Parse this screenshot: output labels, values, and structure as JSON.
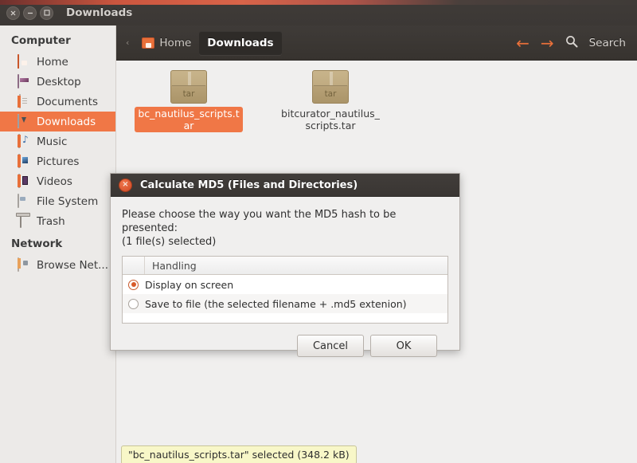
{
  "window": {
    "title": "Downloads",
    "controls": [
      {
        "name": "close",
        "glyph": "×"
      },
      {
        "name": "minimize",
        "glyph": "−"
      },
      {
        "name": "maximize",
        "glyph": "□"
      }
    ]
  },
  "sidebar": {
    "sections": [
      {
        "heading": "Computer",
        "items": [
          {
            "label": "Home",
            "icon": "home-icon",
            "selected": false
          },
          {
            "label": "Desktop",
            "icon": "desktop-icon",
            "selected": false
          },
          {
            "label": "Documents",
            "icon": "documents-icon",
            "selected": false
          },
          {
            "label": "Downloads",
            "icon": "downloads-icon",
            "selected": true
          },
          {
            "label": "Music",
            "icon": "music-icon",
            "selected": false
          },
          {
            "label": "Pictures",
            "icon": "pictures-icon",
            "selected": false
          },
          {
            "label": "Videos",
            "icon": "videos-icon",
            "selected": false
          },
          {
            "label": "File System",
            "icon": "file-system-icon",
            "selected": false
          },
          {
            "label": "Trash",
            "icon": "trash-icon",
            "selected": false
          }
        ]
      },
      {
        "heading": "Network",
        "items": [
          {
            "label": "Browse Net...",
            "icon": "network-icon",
            "selected": false
          }
        ]
      }
    ]
  },
  "toolbar": {
    "separator": "‹",
    "breadcrumbs": [
      {
        "label": "Home",
        "active": false
      },
      {
        "label": "Downloads",
        "active": true
      }
    ],
    "back_glyph": "←",
    "forward_glyph": "→",
    "search_label": "Search"
  },
  "files": [
    {
      "name": "bc_nautilus_scripts.tar",
      "type_label": "tar",
      "selected": true
    },
    {
      "name": "bitcurator_nautilus_scripts.tar",
      "type_label": "tar",
      "selected": false
    }
  ],
  "status": {
    "text": "\"bc_nautilus_scripts.tar\" selected (348.2 kB)"
  },
  "dialog": {
    "title": "Calculate MD5 (Files and Directories)",
    "close_glyph": "×",
    "prompt_line1": "Please choose the way you want the MD5 hash to be presented:",
    "prompt_line2": "(1 file(s) selected)",
    "list": {
      "column_header": "Handling",
      "options": [
        {
          "label": "Display on screen",
          "selected": true
        },
        {
          "label": "Save to file (the selected filename + .md5 extenion)",
          "selected": false
        }
      ]
    },
    "buttons": {
      "cancel": "Cancel",
      "ok": "OK"
    }
  },
  "colors": {
    "accent": "#f07746",
    "titlebar": "#3f3b38",
    "sidebar_bg": "#eceae8",
    "content_bg": "#f0efee",
    "status_bg": "#f8f7c8",
    "radio_on": "#d85a2a"
  }
}
